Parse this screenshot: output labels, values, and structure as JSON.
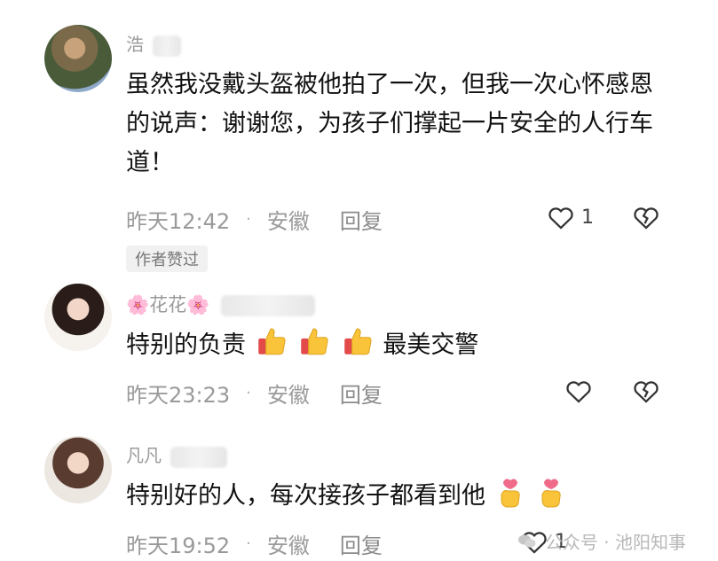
{
  "comments": [
    {
      "name_visible": "浩",
      "text": "虽然我没戴头盔被他拍了一次，但我一次心怀感恩的说声：谢谢您，为孩子们撑起一片安全的人行车道！",
      "time": "昨天12:42",
      "location": "安徽",
      "reply_label": "回复",
      "like_count": "1",
      "badge": "作者赞过"
    },
    {
      "name_visible": "🌸花花🌸",
      "text_before": "特别的负责",
      "text_after": "最美交警",
      "time": "昨天23:23",
      "location": "安徽",
      "reply_label": "回复"
    },
    {
      "name_visible": "凡凡",
      "text": "特别好的人，每次接孩子都看到他",
      "time": "昨天19:52",
      "location": "安徽",
      "reply_label": "回复",
      "like_count": "1"
    }
  ],
  "watermark": "公众号 · 池阳知事",
  "icons": {
    "heart": "heart-outline-icon",
    "dislike": "broken-heart-icon",
    "thumbs_up": "thumbs-up-emoji",
    "finger_heart": "finger-heart-emoji",
    "wechat": "wechat-icon"
  }
}
